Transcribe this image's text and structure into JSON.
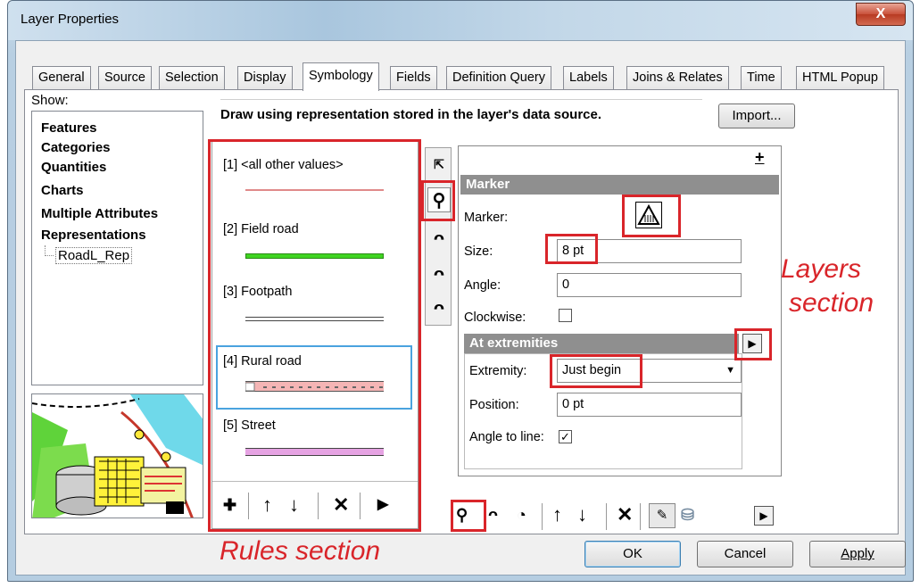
{
  "window": {
    "title": "Layer Properties",
    "close_label": "X"
  },
  "tabs": [
    {
      "label": "General"
    },
    {
      "label": "Source"
    },
    {
      "label": "Selection"
    },
    {
      "label": "Display"
    },
    {
      "label": "Symbology"
    },
    {
      "label": "Fields"
    },
    {
      "label": "Definition Query"
    },
    {
      "label": "Labels"
    },
    {
      "label": "Joins & Relates"
    },
    {
      "label": "Time"
    },
    {
      "label": "HTML Popup"
    }
  ],
  "show": {
    "label": "Show:",
    "items": [
      "Features",
      "Categories",
      "Quantities",
      "Charts",
      "Multiple Attributes",
      "Representations"
    ],
    "subitem": "RoadL_Rep"
  },
  "description": "Draw using representation stored in the layer's data source.",
  "import_label": "Import...",
  "rules": [
    {
      "label": "[1] <all other values>"
    },
    {
      "label": "[2] Field road"
    },
    {
      "label": "[3] Footpath"
    },
    {
      "label": "[4] Rural road"
    },
    {
      "label": "[5] Street"
    }
  ],
  "properties": {
    "plus_label": "+",
    "marker_header": "Marker",
    "marker_label": "Marker:",
    "size_label": "Size:",
    "size_value": "8 pt",
    "angle_label": "Angle:",
    "angle_value": "0",
    "clockwise_label": "Clockwise:",
    "extremities_header": "At extremities",
    "extremity_label": "Extremity:",
    "extremity_value": "Just begin",
    "position_label": "Position:",
    "position_value": "0 pt",
    "angle_to_line_label": "Angle to line:"
  },
  "annotations": {
    "layers_line1": "Layers",
    "layers_line2": "section",
    "rules": "Rules section"
  },
  "buttons": {
    "ok": "OK",
    "cancel": "Cancel",
    "apply": "Apply"
  },
  "colors": {
    "highlight": "#d9252a",
    "field_road": "#3fd421",
    "street": "#e6a3e3",
    "rural_road": "#f5b5b5",
    "all_other": "#e08a8a"
  }
}
